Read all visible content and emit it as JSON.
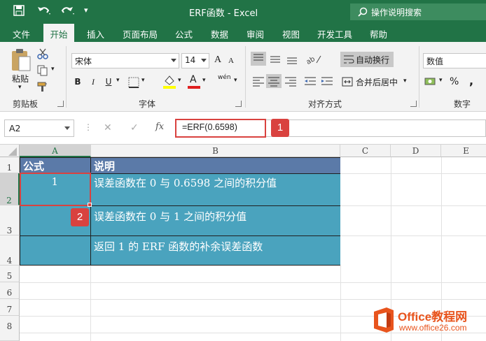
{
  "window": {
    "title": "ERF函数 - Excel",
    "tellme": "操作说明搜索"
  },
  "tabs": [
    "文件",
    "开始",
    "插入",
    "页面布局",
    "公式",
    "数据",
    "审阅",
    "视图",
    "开发工具",
    "帮助"
  ],
  "ribbon": {
    "clipboard": {
      "paste": "粘贴",
      "label": "剪贴板"
    },
    "font": {
      "name": "宋体",
      "size": "14",
      "bold": "B",
      "italic": "I",
      "underline": "U",
      "font_color": "A",
      "size_up": "A",
      "size_down": "A",
      "phonetic": "wén",
      "label": "字体"
    },
    "alignment": {
      "wrap": "自动换行",
      "merge": "合并后居中",
      "label": "对齐方式"
    },
    "number": {
      "format": "数值",
      "percent": "%",
      "comma": ",",
      "label": "数字"
    }
  },
  "formula_bar": {
    "name_box": "A2",
    "formula": "=ERF(0.6598)",
    "fx": "fx"
  },
  "badges": [
    "1",
    "2"
  ],
  "columns": [
    "A",
    "B",
    "C",
    "D",
    "E"
  ],
  "rows": [
    "1",
    "2",
    "3",
    "4",
    "5",
    "6",
    "7",
    "8"
  ],
  "table": {
    "header": [
      "公式",
      "说明"
    ],
    "rows": [
      {
        "a": "1",
        "b": "误差函数在 0 与 0.6598 之间的积分值"
      },
      {
        "a": "",
        "b": "误差函数在 0 与 1 之间的积分值"
      },
      {
        "a": "",
        "b": "返回 1 的 ERF 函数的补余误差函数"
      }
    ]
  },
  "colors": {
    "excel_green": "#217346",
    "table_fill": "#4aa3be",
    "header_fill": "#5b7aa8",
    "highlight": "#d9423f"
  },
  "watermark": {
    "brand": "Office教程网",
    "url": "www.office26.com"
  }
}
